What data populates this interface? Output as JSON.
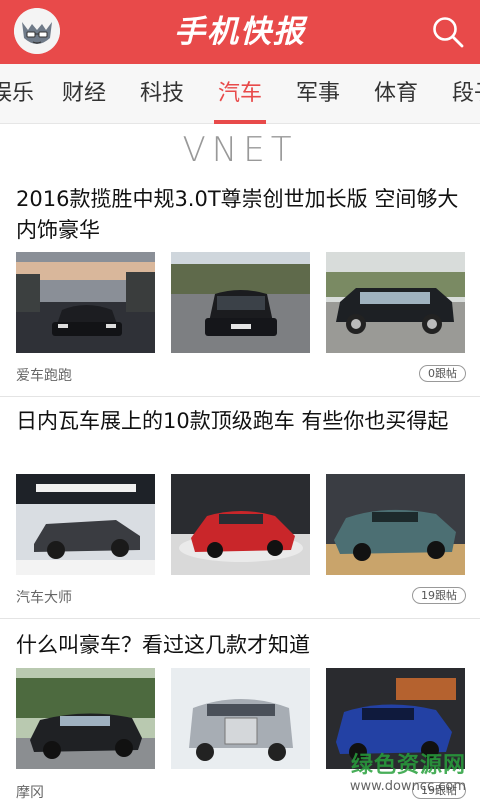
{
  "header": {
    "title": "手机快报",
    "avatar_icon": "avatar-icon",
    "search_icon": "search-icon"
  },
  "tabs": [
    {
      "label": "娱乐",
      "active": false
    },
    {
      "label": "财经",
      "active": false
    },
    {
      "label": "科技",
      "active": false
    },
    {
      "label": "汽车",
      "active": true
    },
    {
      "label": "军事",
      "active": false
    },
    {
      "label": "体育",
      "active": false
    },
    {
      "label": "段子",
      "active": false
    }
  ],
  "brand": "VNET",
  "articles": [
    {
      "title": "2016款揽胜中规3.0T尊崇创世加长版 空间够大 内饰豪华",
      "source": "爱车跑跑",
      "replies": "0跟帖"
    },
    {
      "title": "日内瓦车展上的10款顶级跑车 有些你也买得起",
      "source": "汽车大师",
      "replies": "19跟帖"
    },
    {
      "title": "什么叫豪车？看过这几款才知道",
      "source": "摩冈",
      "replies": "19跟帖"
    }
  ],
  "watermark": {
    "main": "绿色资源网",
    "sub": "www.downcc.com"
  },
  "colors": {
    "accent": "#e84a4a"
  }
}
